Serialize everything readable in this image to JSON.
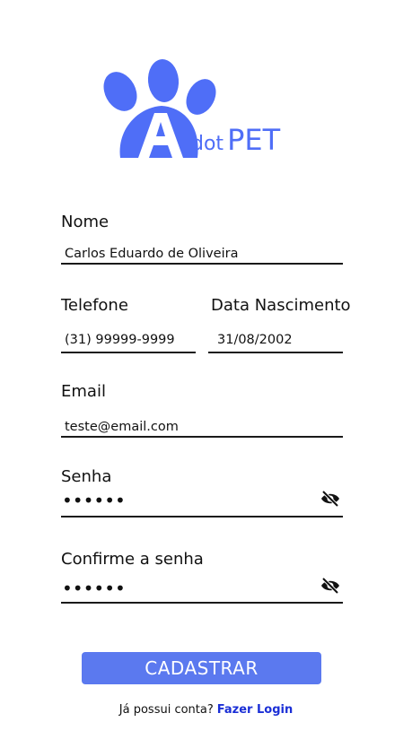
{
  "logo": {
    "dot": "dot",
    "pet": "PET",
    "color": "#4f6ef7"
  },
  "form": {
    "nome": {
      "label": "Nome",
      "value": "Carlos Eduardo de Oliveira"
    },
    "telefone": {
      "label": "Telefone",
      "value": "(31) 99999-9999"
    },
    "nascimento": {
      "label": "Data Nascimento",
      "value": "31/08/2002"
    },
    "email": {
      "label": "Email",
      "value": "teste@email.com"
    },
    "senha": {
      "label": "Senha",
      "value": "••••••",
      "icon": "eye-off-icon"
    },
    "confirma": {
      "label": "Confirme a senha",
      "value": "••••••",
      "icon": "eye-off-icon"
    }
  },
  "submit": {
    "label": "CADASTRAR",
    "color": "#5b79ef"
  },
  "footer": {
    "text": "Já possui conta?",
    "link": "Fazer Login",
    "link_color": "#1b2fd6"
  }
}
